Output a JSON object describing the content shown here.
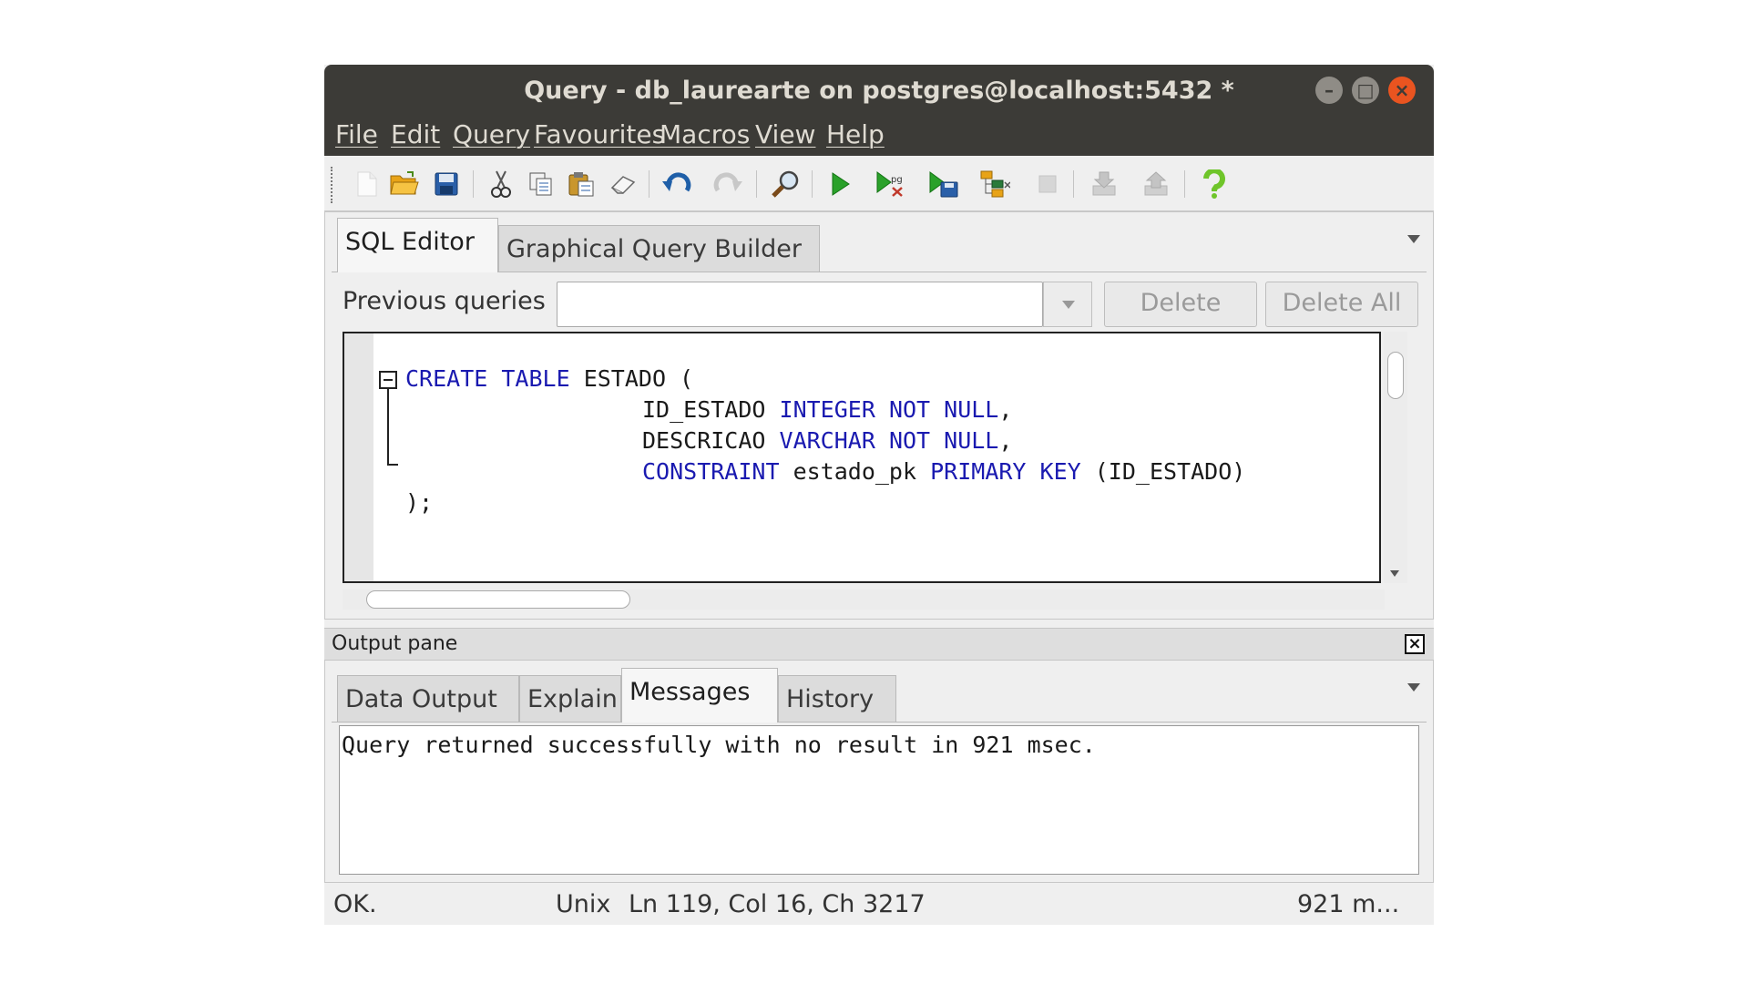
{
  "window": {
    "title": "Query - db_laurearte on postgres@localhost:5432 *",
    "controls": {
      "minimize": "–",
      "maximize": "□",
      "close": "×"
    }
  },
  "menu": [
    "File",
    "Edit",
    "Query",
    "Favourites",
    "Macros",
    "View",
    "Help"
  ],
  "toolbar": {
    "icons": [
      "new-file-icon",
      "open-folder-icon",
      "save-icon",
      "cut-icon",
      "copy-icon",
      "paste-icon",
      "clear-icon",
      "undo-icon",
      "redo-icon",
      "find-icon",
      "execute-icon",
      "execute-pgscript-icon",
      "execute-to-file-icon",
      "explain-icon",
      "cancel-query-icon",
      "move-down-icon",
      "move-up-icon",
      "help-icon"
    ]
  },
  "editor_tabs": [
    "SQL Editor",
    "Graphical Query Builder"
  ],
  "active_editor_tab": "SQL Editor",
  "previous_queries": {
    "label": "Previous queries",
    "value": "",
    "delete_label": "Delete",
    "delete_all_label": "Delete All"
  },
  "sql": {
    "line1": {
      "kw1": "CREATE",
      "kw2": "TABLE",
      "name": "ESTADO ("
    },
    "line2": {
      "col": "ID_ESTADO",
      "type": "INTEGER",
      "constraint": "NOT NULL",
      "end": ","
    },
    "line3": {
      "col": "DESCRICAO",
      "type": "VARCHAR",
      "constraint": "NOT NULL",
      "end": ","
    },
    "line4": {
      "kw": "CONSTRAINT",
      "name": "estado_pk",
      "pk": "PRIMARY KEY",
      "cols": "(ID_ESTADO)"
    },
    "line5": ");"
  },
  "output": {
    "title": "Output pane",
    "close": "×",
    "tabs": [
      "Data Output",
      "Explain",
      "Messages",
      "History"
    ],
    "active_tab": "Messages",
    "message": "Query returned successfully with no result in 921 msec."
  },
  "status": {
    "state": "OK.",
    "line_ending": "Unix",
    "position": "Ln 119, Col 16, Ch 3217",
    "time": "921 m..."
  },
  "colors": {
    "titlebar": "#3c3b37",
    "close_button": "#e95420",
    "keyword": "#1a1ab0"
  }
}
